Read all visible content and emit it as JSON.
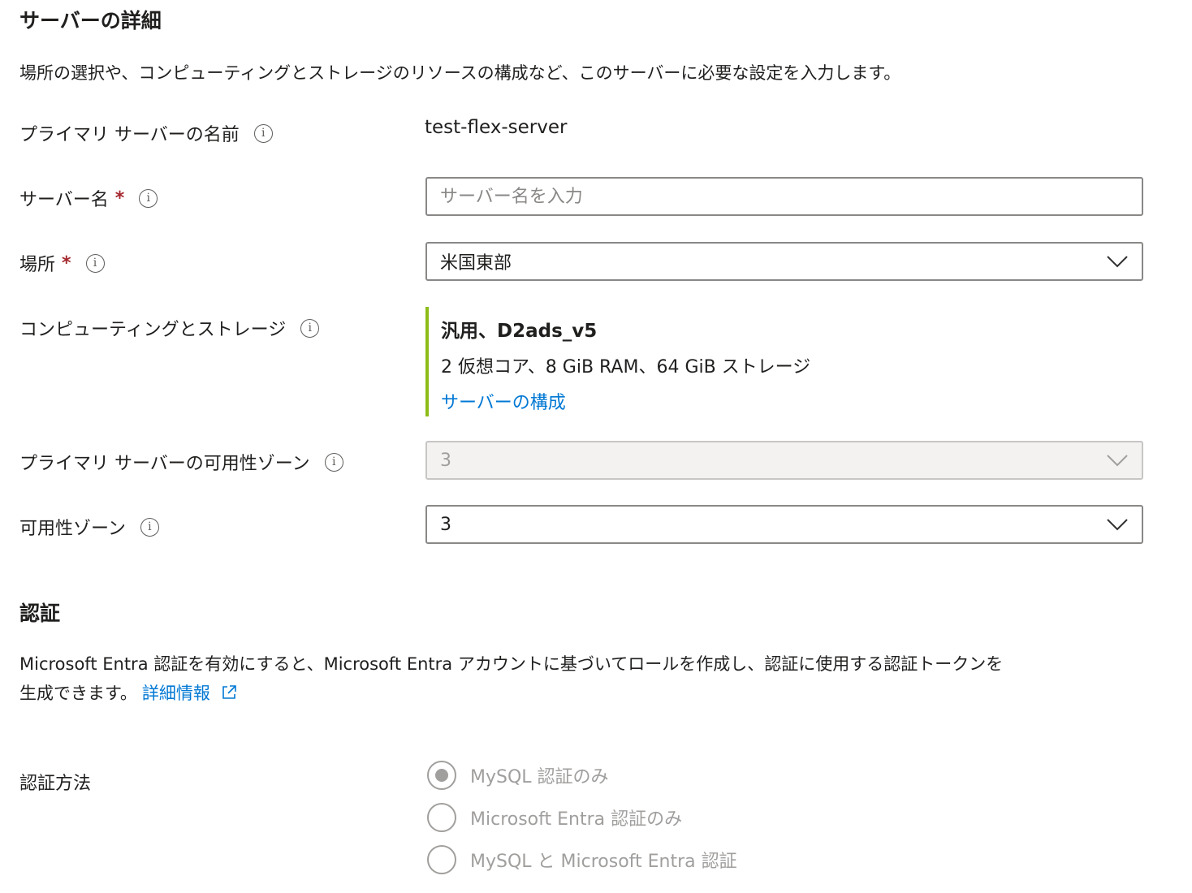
{
  "server_details": {
    "heading": "サーバーの詳細",
    "description": "場所の選択や、コンピューティングとストレージのリソースの構成など、このサーバーに必要な設定を入力します。",
    "primary_server_name": {
      "label": "プライマリ サーバーの名前",
      "value": "test-flex-server"
    },
    "server_name": {
      "label": "サーバー名",
      "required_mark": "*",
      "placeholder": "サーバー名を入力",
      "value": ""
    },
    "location": {
      "label": "場所",
      "required_mark": "*",
      "selected": "米国東部"
    },
    "compute_storage": {
      "label": "コンピューティングとストレージ",
      "tier": "汎用、D2ads_v5",
      "spec": "2 仮想コア、8 GiB RAM、64 GiB ストレージ",
      "configure_link": "サーバーの構成"
    },
    "primary_availability_zone": {
      "label": "プライマリ サーバーの可用性ゾーン",
      "selected": "3",
      "disabled": true
    },
    "availability_zone": {
      "label": "可用性ゾーン",
      "selected": "3"
    }
  },
  "authentication": {
    "heading": "認証",
    "description_line1": "Microsoft Entra 認証を有効にすると、Microsoft Entra アカウントに基づいてロールを作成し、認証に使用する認証トークンを",
    "description_line2": "生成できます。",
    "learn_more_link": "詳細情報",
    "method_label": "認証方法",
    "options": [
      {
        "label": "MySQL 認証のみ",
        "checked": true
      },
      {
        "label": "Microsoft Entra 認証のみ",
        "checked": false
      },
      {
        "label": "MySQL と Microsoft Entra 認証",
        "checked": false
      }
    ]
  },
  "colors": {
    "link": "#0078d4",
    "required": "#a4262c",
    "compute_accent": "#8cbd18",
    "border": "#8a8886",
    "disabled_bg": "#f3f2f1"
  },
  "icons": {
    "info": "info-icon",
    "chevron": "chevron-down-icon",
    "external": "external-link-icon"
  }
}
